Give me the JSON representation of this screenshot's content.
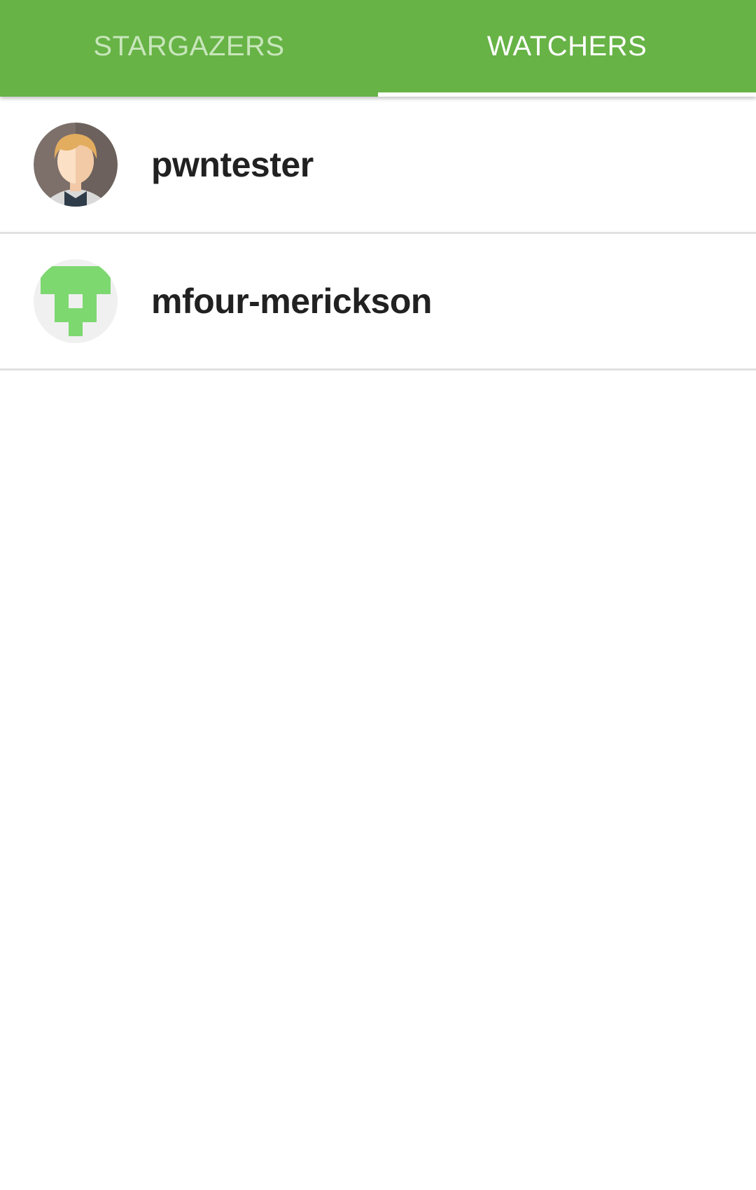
{
  "tabs": [
    {
      "label": "STARGAZERS",
      "active": false
    },
    {
      "label": "WATCHERS",
      "active": true
    }
  ],
  "watchers": [
    {
      "username": "pwntester",
      "avatar_icon": "person-avatar-icon"
    },
    {
      "username": "mfour-merickson",
      "avatar_icon": "identicon-avatar-icon"
    }
  ],
  "colors": {
    "tabbar": "#67b346",
    "identicon_green": "#7dd870",
    "identicon_bg": "#f0f0f0"
  }
}
